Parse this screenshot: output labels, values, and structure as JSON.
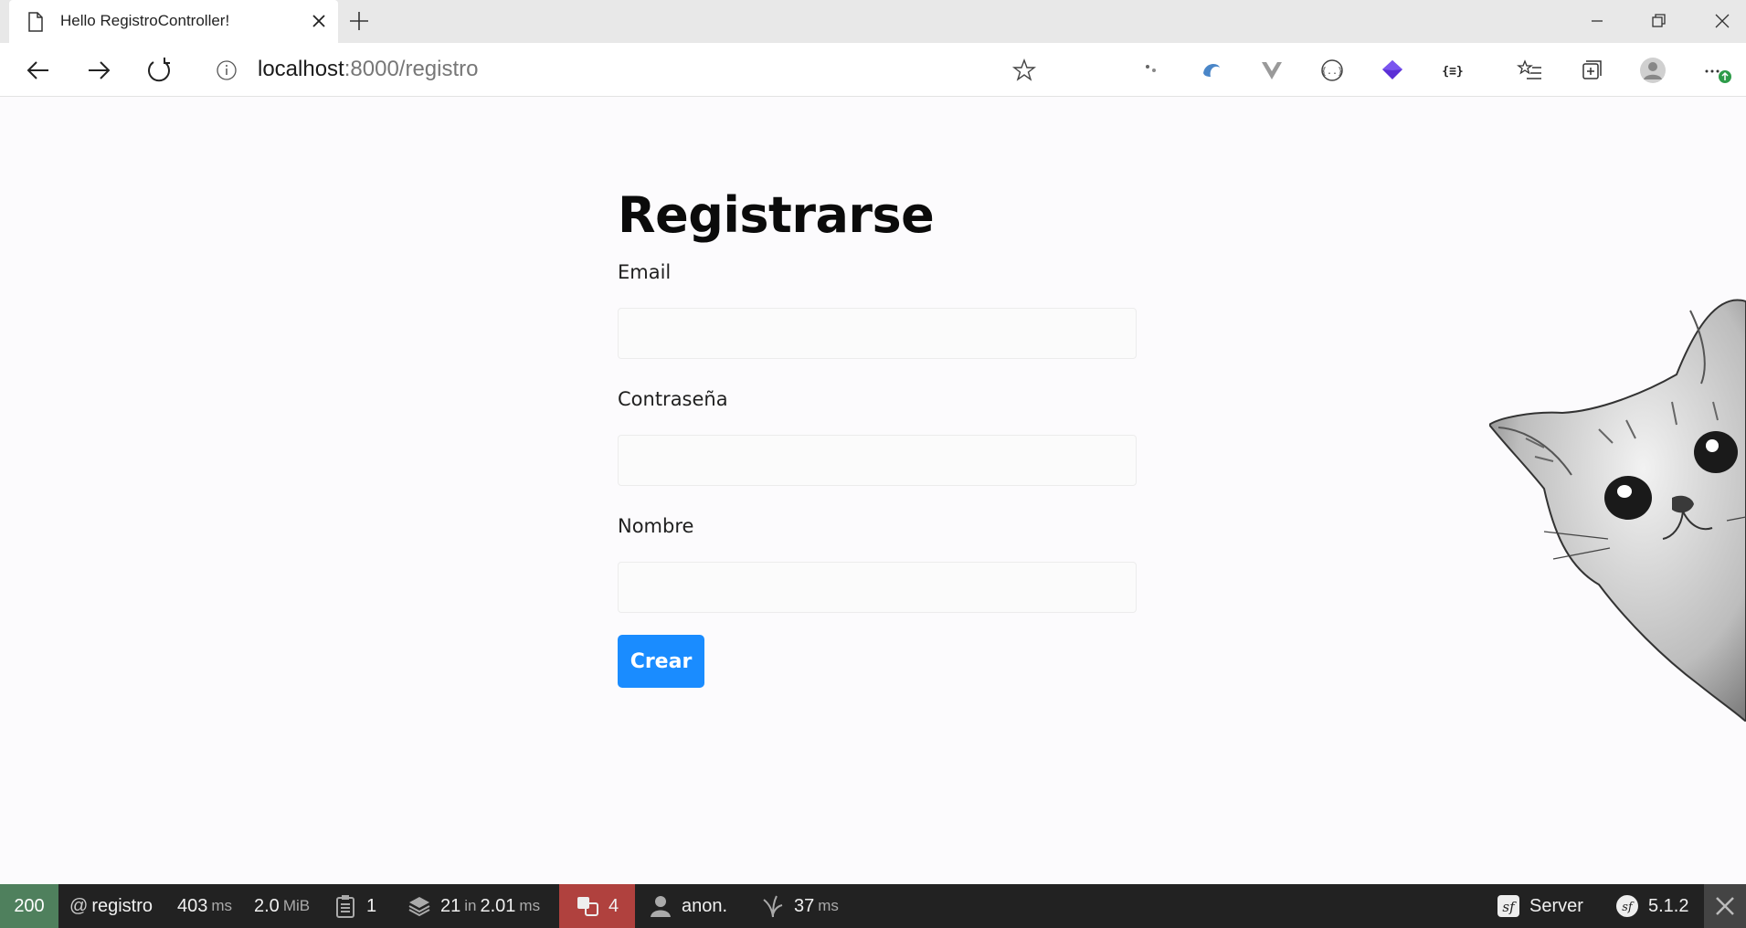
{
  "browser": {
    "tab_title": "Hello RegistroController!",
    "url_host": "localhost",
    "url_rest": ":8000/registro"
  },
  "page": {
    "title": "Registrarse",
    "fields": [
      {
        "label": "Email",
        "value": ""
      },
      {
        "label": "Contraseña",
        "value": ""
      },
      {
        "label": "Nombre",
        "value": ""
      }
    ],
    "submit_label": "Crear"
  },
  "debug_toolbar": {
    "status_code": "200",
    "route_prefix": "@",
    "route": "registro",
    "time_value": "403",
    "time_unit": "ms",
    "memory_value": "2.0",
    "memory_unit": "MiB",
    "logs_count": "1",
    "queries_count": "21",
    "queries_in": "in",
    "queries_time": "2.01",
    "queries_unit": "ms",
    "translations_count": "4",
    "user": "anon.",
    "twig_time": "37",
    "twig_unit": "ms",
    "server_label": "Server",
    "symfony_version": "5.1.2"
  },
  "colors": {
    "primary_button": "#1a8cff",
    "status_ok": "#4f805d",
    "translation_badge": "#b0413e",
    "toolbar_bg": "#222222"
  }
}
